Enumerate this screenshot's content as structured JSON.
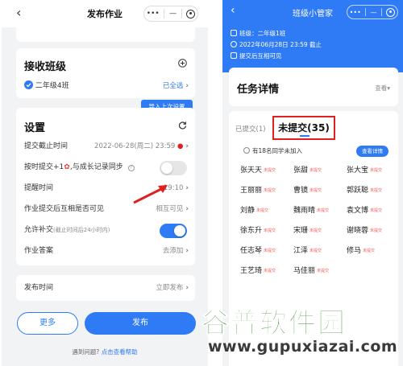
{
  "left": {
    "nav": {
      "back": "‹",
      "title": "发布作业"
    },
    "class_card": {
      "title": "接收班级",
      "class_name": "二年级4班",
      "select_all": "已全选"
    },
    "tooltip": "导入上次设置",
    "settings": {
      "title": "设置",
      "deadline_label": "提交截止时间",
      "deadline_value": "2022-06-28(周二) 23:59",
      "sync_label_a": "按时提交+1",
      "sync_label_b": ",与成长记录同步",
      "remind_label": "提醒时间",
      "remind_value": "19:10",
      "visible_label": "作业提交后互相是否可见",
      "visible_value": "相互可见",
      "late_label": "允许补交",
      "late_hint": "(截止时间后24小时内)",
      "answer_label": "作业答案",
      "answer_value": "去添加"
    },
    "publish_time": {
      "label": "发布时间",
      "value": "立即发布"
    },
    "buttons": {
      "more": "更多",
      "publish": "发布"
    },
    "help": {
      "prefix": "遇到问题?",
      "link": "点击查看帮助"
    }
  },
  "right": {
    "nav": {
      "back": "‹",
      "title": "班级小管家"
    },
    "info": {
      "class_line": "班级：二年级1班",
      "deadline_line": "2022年06月28日 23:59 截止",
      "visible_line": "提交后互相可见"
    },
    "task": {
      "title": "任务详情",
      "view": "查看"
    },
    "tabs": {
      "submitted": "已提交(1)",
      "unsubmitted": "未提交(35)"
    },
    "notice": "有18名同学未加入",
    "detail_button": "查看详情",
    "status_tag": "未提交",
    "students": [
      "张天天",
      "张甜",
      "张大宝",
      "王丽丽",
      "曹镜",
      "郭跃聪",
      "刘静",
      "魏雨晴",
      "袁文博",
      "徐东升",
      "宋珊",
      "谢晓蓉",
      "任志琴",
      "江泽",
      "修马",
      "王艺琦",
      "马佳丽"
    ]
  },
  "watermark": {
    "cn": "谷普软件园",
    "url": "www.gupuxiazai.com"
  },
  "colors": {
    "accent": "#2f7bf5",
    "highlight_box": "#e02020",
    "watermark_green": "#3b8e2f"
  }
}
